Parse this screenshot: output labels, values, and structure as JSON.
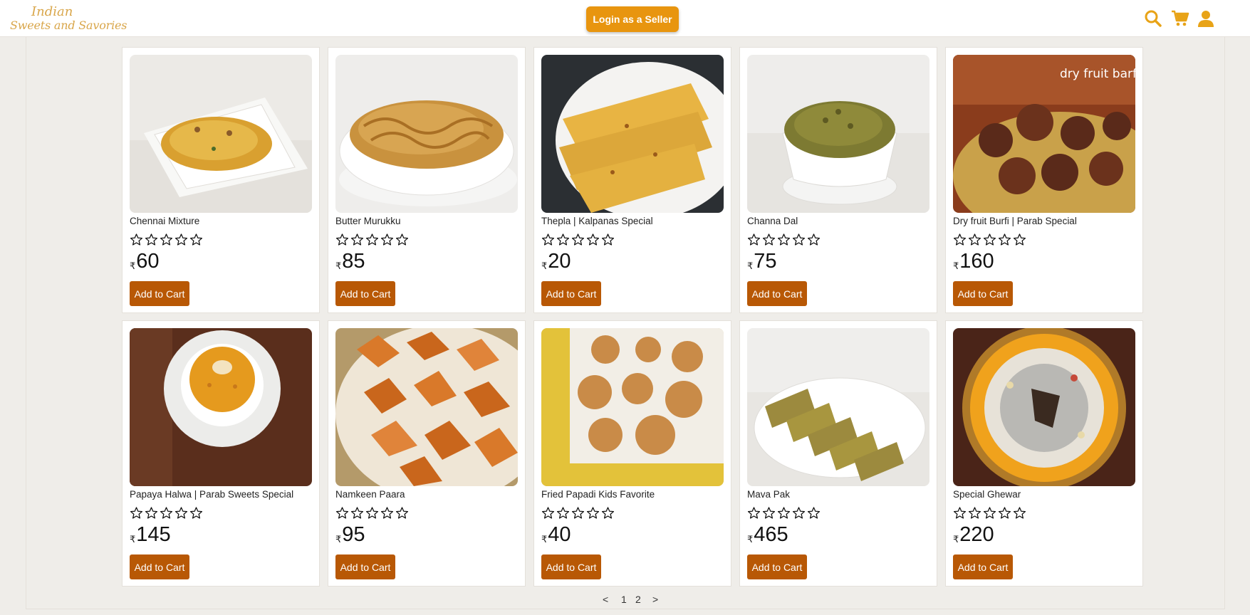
{
  "header": {
    "logo_line1": "Indian",
    "logo_line2": "Sweets and Savories",
    "seller_button": "Login as a Seller",
    "icons": [
      "search-icon",
      "cart-icon",
      "user-icon"
    ],
    "accent_color": "#e8a317"
  },
  "currency_symbol": "₹",
  "add_to_cart_label": "Add to Cart",
  "products": [
    {
      "name": "Chennai Mixture",
      "price": "60",
      "rating": 0
    },
    {
      "name": "Butter Murukku",
      "price": "85",
      "rating": 0
    },
    {
      "name": "Thepla | Kalpanas Special",
      "price": "20",
      "rating": 0
    },
    {
      "name": "Channa Dal",
      "price": "75",
      "rating": 0
    },
    {
      "name": "Dry fruit Burfi | Parab Special",
      "price": "160",
      "rating": 0,
      "image_text": "dry fruit barfi"
    },
    {
      "name": "Papaya Halwa | Parab Sweets Special",
      "price": "145",
      "rating": 0
    },
    {
      "name": "Namkeen Paara",
      "price": "95",
      "rating": 0
    },
    {
      "name": "Fried Papadi Kids Favorite",
      "price": "40",
      "rating": 0
    },
    {
      "name": "Mava Pak",
      "price": "465",
      "rating": 0
    },
    {
      "name": "Special Ghewar",
      "price": "220",
      "rating": 0
    }
  ],
  "pagination": {
    "prev": "<",
    "pages": [
      "1",
      "2"
    ],
    "next": ">"
  },
  "colors": {
    "button": "#b85805",
    "seller_button": "#e8950f",
    "background": "#efede9"
  }
}
